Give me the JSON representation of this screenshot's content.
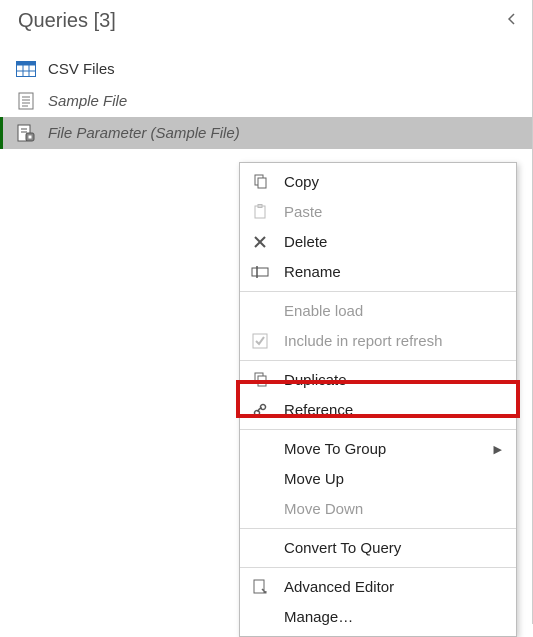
{
  "header": {
    "title": "Queries [3]"
  },
  "queries": [
    {
      "label": "CSV Files",
      "icon": "table",
      "italic": false,
      "selected": false
    },
    {
      "label": "Sample File",
      "icon": "document",
      "italic": true,
      "selected": false
    },
    {
      "label": "File Parameter (Sample File)",
      "icon": "parameter",
      "italic": true,
      "selected": true
    }
  ],
  "menu": {
    "copy": "Copy",
    "paste": "Paste",
    "delete": "Delete",
    "rename": "Rename",
    "enable_load": "Enable load",
    "include_refresh": "Include in report refresh",
    "duplicate": "Duplicate",
    "reference": "Reference",
    "move_to_group": "Move To Group",
    "move_up": "Move Up",
    "move_down": "Move Down",
    "convert_to_query": "Convert To Query",
    "advanced_editor": "Advanced Editor",
    "manage": "Manage…"
  }
}
